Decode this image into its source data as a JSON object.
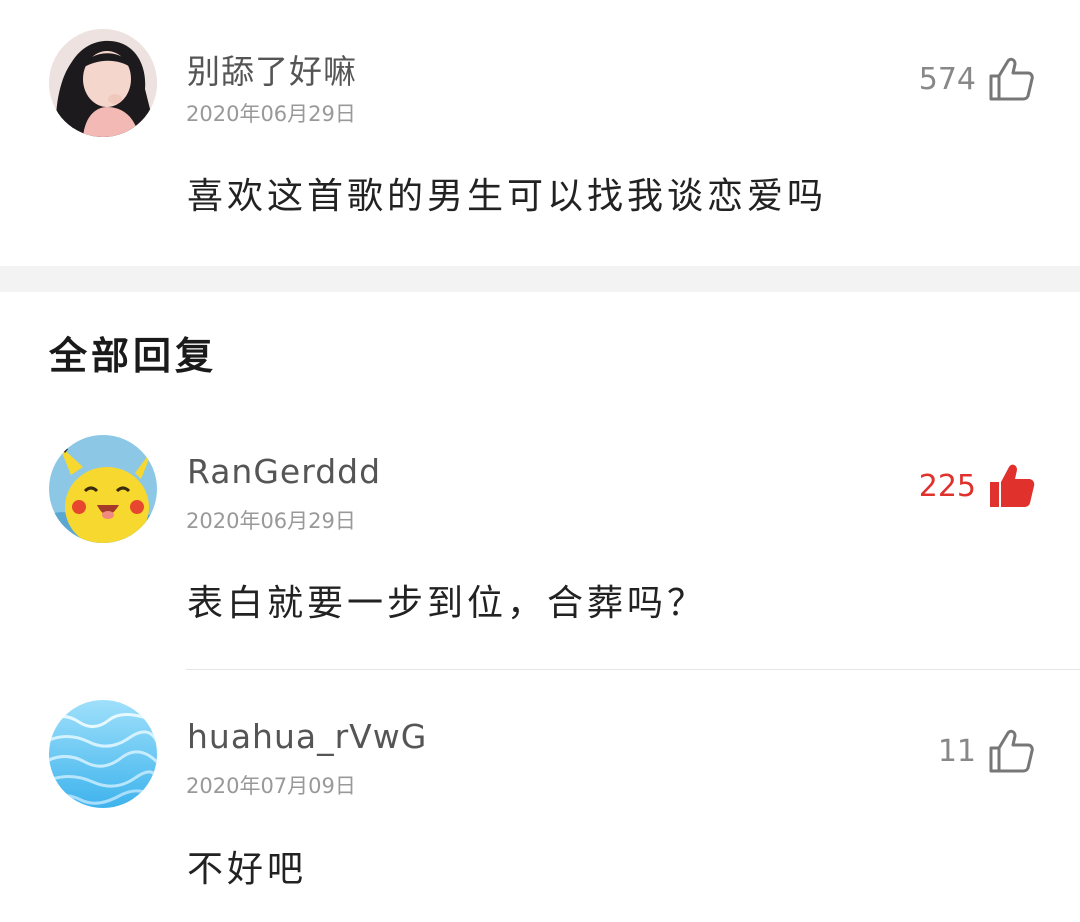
{
  "main_comment": {
    "username": "别舔了好嘛",
    "date": "2020年06月29日",
    "text": "喜欢这首歌的男生可以找我谈恋爱吗",
    "likes": "574",
    "liked": false,
    "avatar_icon": "user-avatar-photo"
  },
  "replies_section": {
    "title": "全部回复"
  },
  "replies": [
    {
      "username": "RanGerddd",
      "date": "2020年06月29日",
      "text": "表白就要一步到位，合葬吗？",
      "likes": "225",
      "liked": true,
      "avatar_icon": "pikachu-avatar"
    },
    {
      "username": "huahua_rVwG",
      "date": "2020年07月09日",
      "text": "不好吧",
      "likes": "11",
      "liked": false,
      "avatar_icon": "water-avatar"
    }
  ],
  "colors": {
    "like_active": "#e0312d",
    "like_inactive": "#888888",
    "section_gap": "#f3f3f3"
  }
}
